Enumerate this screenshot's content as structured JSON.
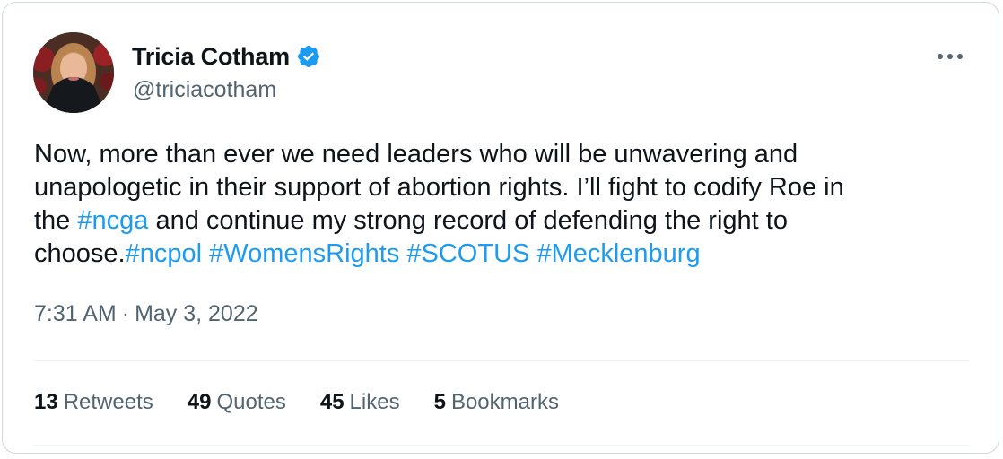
{
  "tweet": {
    "author": {
      "display_name": "Tricia Cotham",
      "handle": "@triciacotham",
      "verified": true
    },
    "text_lines": [
      [
        {
          "t": "Now, more than ever we need leaders who will be unwavering and",
          "tag": false
        }
      ],
      [
        {
          "t": "unapologetic in their support of abortion rights. I’ll fight to codify Roe in",
          "tag": false
        }
      ],
      [
        {
          "t": "the ",
          "tag": false
        },
        {
          "t": "#ncga",
          "tag": true
        },
        {
          "t": " and continue my strong record of defending the right to",
          "tag": false
        }
      ],
      [
        {
          "t": "choose.",
          "tag": false
        },
        {
          "t": "#ncpol",
          "tag": true
        },
        {
          "t": " ",
          "tag": false
        },
        {
          "t": "#WomensRights",
          "tag": true
        },
        {
          "t": " ",
          "tag": false
        },
        {
          "t": "#SCOTUS",
          "tag": true
        },
        {
          "t": " ",
          "tag": false
        },
        {
          "t": "#Mecklenburg",
          "tag": true
        }
      ]
    ],
    "time": "7:31 AM",
    "separator": "·",
    "date": "May 3, 2022",
    "stats": [
      {
        "count": "13",
        "label": "Retweets"
      },
      {
        "count": "49",
        "label": "Quotes"
      },
      {
        "count": "45",
        "label": "Likes"
      },
      {
        "count": "5",
        "label": "Bookmarks"
      }
    ]
  },
  "icons": {
    "verified": "verified-badge-icon",
    "more": "more-options-icon"
  },
  "colors": {
    "link": "#1d9bf0",
    "text": "#0f1419",
    "secondary": "#536471",
    "border": "#cfd9de",
    "divider": "#eff3f4"
  }
}
